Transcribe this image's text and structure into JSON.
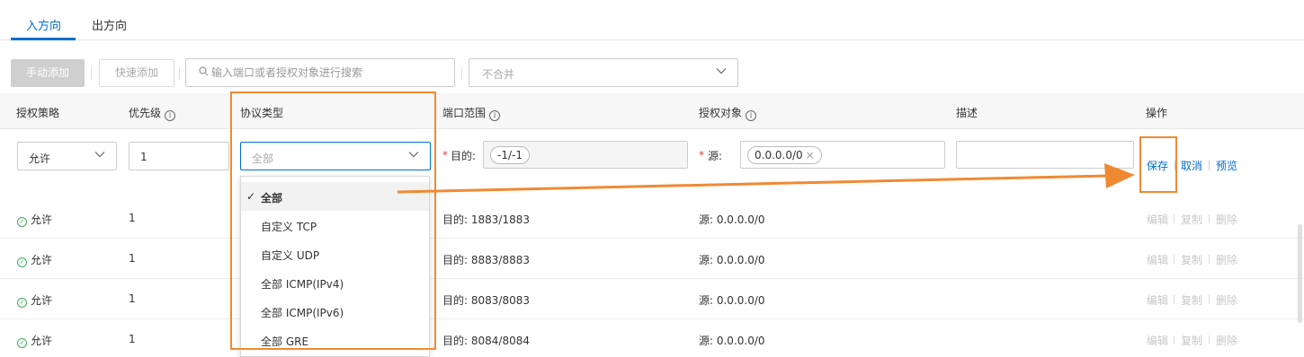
{
  "tabs": [
    {
      "label": "入方向",
      "active": true
    },
    {
      "label": "出方向",
      "active": false
    }
  ],
  "toolbar": {
    "manual_add": "手动添加",
    "quick_add": "快速添加",
    "search_placeholder": "输入端口或者授权对象进行搜索",
    "merge_value": "不合并"
  },
  "columns": {
    "policy": "授权策略",
    "priority": "优先级",
    "protocol": "协议类型",
    "port_range": "端口范围",
    "auth_object": "授权对象",
    "description": "描述",
    "action": "操作"
  },
  "edit_row": {
    "policy": "允许",
    "priority": "1",
    "protocol": "全部",
    "port_label": "目的:",
    "port_chip": "-1/-1",
    "source_label": "源:",
    "source_chip": "0.0.0.0/0",
    "description": "",
    "save": "保存",
    "cancel": "取消",
    "preview": "预览"
  },
  "rows": [
    {
      "policy": "允许",
      "priority": "1",
      "port": "目的: 1883/1883",
      "source": "源: 0.0.0.0/0"
    },
    {
      "policy": "允许",
      "priority": "1",
      "port": "目的: 8883/8883",
      "source": "源: 0.0.0.0/0"
    },
    {
      "policy": "允许",
      "priority": "1",
      "port": "目的: 8083/8083",
      "source": "源: 0.0.0.0/0"
    },
    {
      "policy": "允许",
      "priority": "1",
      "port": "目的: 8084/8084",
      "source": "源: 0.0.0.0/0"
    }
  ],
  "row_actions": {
    "edit": "编辑",
    "copy": "复制",
    "delete": "删除"
  },
  "protocol_dropdown": {
    "options": [
      "全部",
      "自定义 TCP",
      "自定义 UDP",
      "全部 ICMP(IPv4)",
      "全部 ICMP(IPv6)",
      "全部 GRE"
    ],
    "selected": "全部",
    "check": "✓"
  },
  "colors": {
    "accent": "#0070cc",
    "highlight": "#f08a32",
    "allow": "#3eae5b",
    "required": "#e53e31"
  },
  "icons": {
    "search": "search-icon",
    "chevron": "chevron-down-icon",
    "info": "info-icon",
    "allow": "check-circle-icon",
    "remove": "close-icon"
  }
}
